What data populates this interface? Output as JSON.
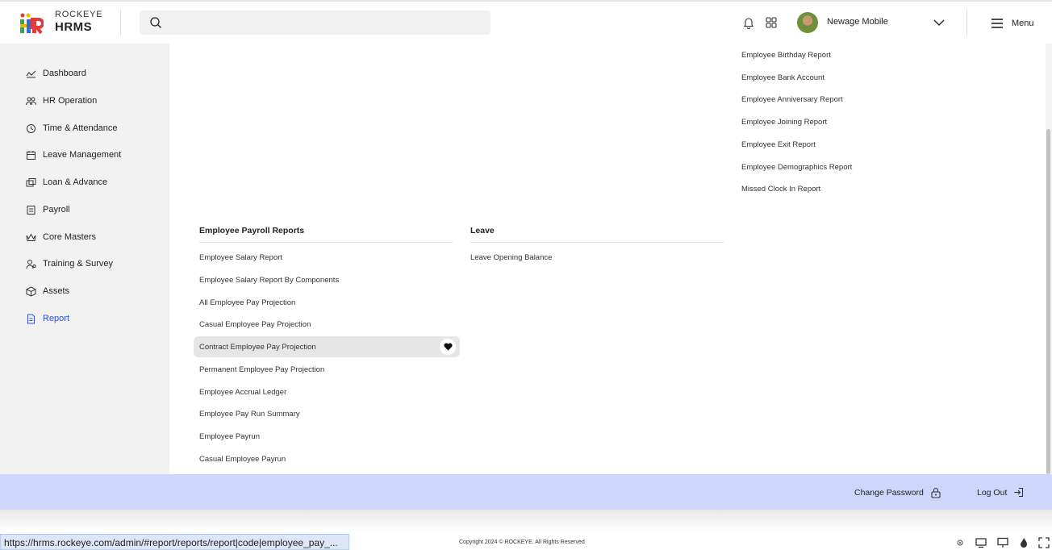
{
  "brand": {
    "line1": "ROCKEYE",
    "line2": "HRMS"
  },
  "search": {
    "value": ""
  },
  "user": {
    "name": "Newage Mobile"
  },
  "menu_label": "Menu",
  "sidebar": {
    "items": [
      {
        "label": "Dashboard",
        "icon": "dashboard-icon"
      },
      {
        "label": "HR Operation",
        "icon": "people-icon"
      },
      {
        "label": "Time & Attendance",
        "icon": "clock-icon"
      },
      {
        "label": "Leave Management",
        "icon": "calendar-icon"
      },
      {
        "label": "Loan & Advance",
        "icon": "money-icon"
      },
      {
        "label": "Payroll",
        "icon": "payroll-icon"
      },
      {
        "label": "Core Masters",
        "icon": "crown-icon"
      },
      {
        "label": "Training & Survey",
        "icon": "training-icon"
      },
      {
        "label": "Assets",
        "icon": "box-icon"
      },
      {
        "label": "Report",
        "icon": "report-icon",
        "active": true
      }
    ]
  },
  "employee_reports": [
    "Employee Birthday Report",
    "Employee Bank Account",
    "Employee Anniversary Report",
    "Employee Joining Report",
    "Employee Exit Report",
    "Employee Demographics Report",
    "Missed Clock In Report"
  ],
  "payroll_section": {
    "title": "Employee Payroll Reports",
    "items": [
      "Employee Salary Report",
      "Employee Salary Report By Components",
      "All Employee Pay Projection",
      "Casual Employee Pay Projection",
      "Contract Employee Pay Projection",
      "Permanent Employee Pay Projection",
      "Employee Accrual Ledger",
      "Employee Pay Run Summary",
      "Employee Payrun",
      "Casual Employee Payrun"
    ],
    "hovered_index": 4
  },
  "leave_section": {
    "title": "Leave",
    "items": [
      "Leave Opening Balance"
    ]
  },
  "footer": {
    "change_password": "Change Password",
    "logout": "Log Out",
    "copyright": "Copyright 2024 © ROCKEYE. All Rights Reserved"
  },
  "status_url": "https://hrms.rockeye.com/admin/#report/reports/report|code|employee_pay_...",
  "colors": {
    "accent": "#2d4fd6",
    "footer_bg": "#ccd7fb",
    "sidebar_bg": "#f2f2f2"
  }
}
